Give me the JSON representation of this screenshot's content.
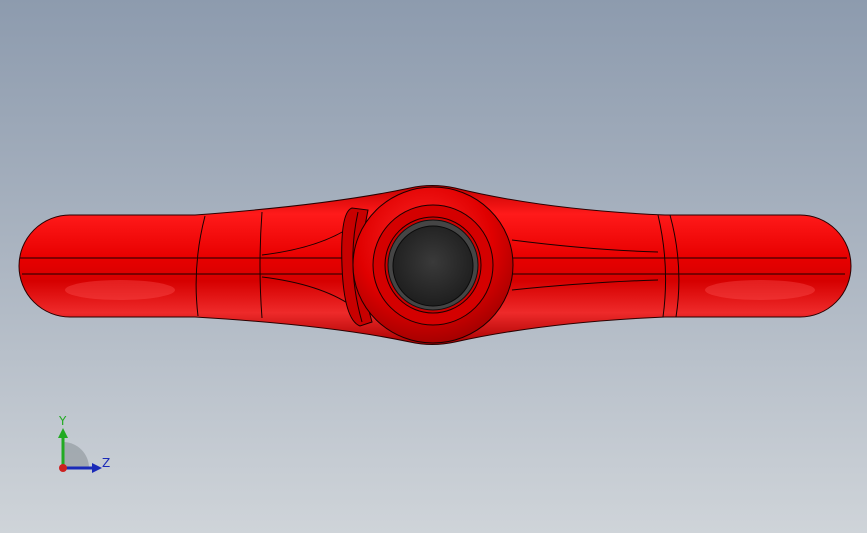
{
  "viewport": {
    "background_top": "#8d9bae",
    "background_bottom": "#cfd4d9"
  },
  "model": {
    "body_color": "#e00000",
    "edge_color": "#1a0000",
    "hole_color": "#2b2b2b"
  },
  "triad": {
    "y_label": "Y",
    "z_label": "Z",
    "y_color": "#22aa22",
    "z_color": "#1a2ab8",
    "x_color": "#cc2020"
  }
}
